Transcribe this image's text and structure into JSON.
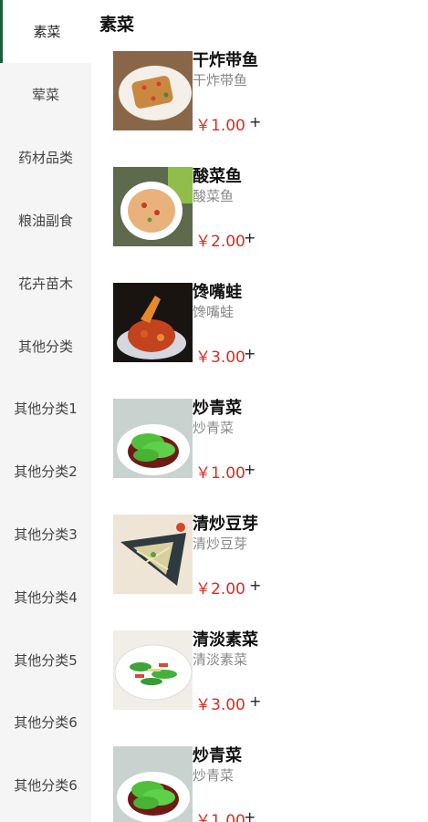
{
  "sidebar": {
    "items": [
      {
        "label": "素菜"
      },
      {
        "label": "荤菜"
      },
      {
        "label": "药材品类"
      },
      {
        "label": "粮油副食"
      },
      {
        "label": "花卉苗木"
      },
      {
        "label": "其他分类"
      },
      {
        "label": "其他分类1"
      },
      {
        "label": "其他分类2"
      },
      {
        "label": "其他分类3"
      },
      {
        "label": "其他分类4"
      },
      {
        "label": "其他分类5"
      },
      {
        "label": "其他分类6"
      },
      {
        "label": "其他分类6"
      }
    ],
    "active_index": 0
  },
  "main": {
    "title": "素菜",
    "products": [
      {
        "name": "干炸带鱼",
        "desc": "干炸带鱼",
        "price": "￥1.00",
        "add": "+",
        "image": "fried-hairtail-photo"
      },
      {
        "name": "酸菜鱼",
        "desc": "酸菜鱼",
        "price": "￥2.00",
        "add": "+",
        "image": "pickled-fish-photo"
      },
      {
        "name": "馋嘴蛙",
        "desc": "馋嘴蛙",
        "price": "￥3.00",
        "add": "+",
        "image": "spicy-frog-photo"
      },
      {
        "name": "炒青菜",
        "desc": "炒青菜",
        "price": "￥1.00",
        "add": "+",
        "image": "stir-fried-greens-photo"
      },
      {
        "name": "清炒豆芽",
        "desc": "清炒豆芽",
        "price": "￥2.00",
        "add": "+",
        "image": "bean-sprouts-photo"
      },
      {
        "name": "清淡素菜",
        "desc": "清淡素菜",
        "price": "￥3.00",
        "add": "+",
        "image": "light-vegetable-photo"
      },
      {
        "name": "炒青菜",
        "desc": "炒青菜",
        "price": "￥1.00",
        "add": "+",
        "image": "stir-fried-greens-photo"
      }
    ]
  },
  "colors": {
    "price": "#e02a1e",
    "active_indicator": "#1b5e3b",
    "sidebar_bg": "#f5f5f5"
  }
}
